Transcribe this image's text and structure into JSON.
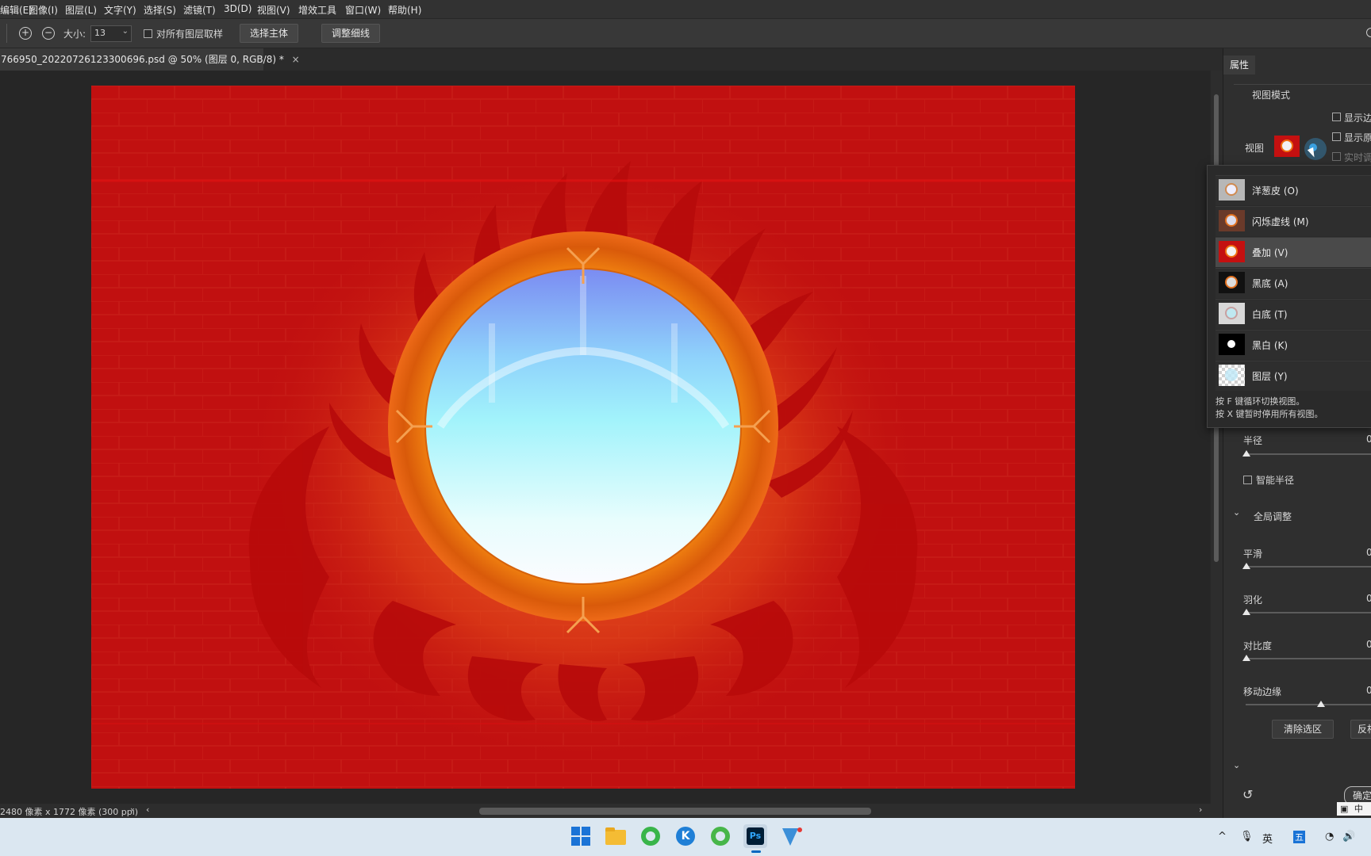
{
  "menu": [
    "编辑(E)",
    "图像(I)",
    "图层(L)",
    "文字(Y)",
    "选择(S)",
    "滤镜(T)",
    "3D(D)",
    "视图(V)",
    "增效工具",
    "窗口(W)",
    "帮助(H)"
  ],
  "options_bar": {
    "size_label": "大小:",
    "size_value": "13",
    "sample_all_layers_label": "对所有图层取样",
    "select_subject_button": "选择主体",
    "refine_hair_button": "调整细线"
  },
  "document_tab": {
    "title": "766950_20220726123300696.psd @ 50% (图层 0, RGB/8) *",
    "close_glyph": "×"
  },
  "status_bar": {
    "doc_info": "2480 像素 x 1772 像素 (300 ppi)",
    "arrow": "›",
    "scroll_left": "‹",
    "scroll_right": "›"
  },
  "properties_panel": {
    "tab_label": "属性",
    "view_mode_section": "视图模式",
    "view_label": "视图",
    "show_edge_checkbox": "显示边",
    "show_original_checkbox": "显示原",
    "realtime_checkbox": "实时调",
    "radius_label": "半径",
    "radius_value": "0",
    "smart_radius_label": "智能半径",
    "global_refine_section": "全局调整",
    "smooth_label": "平滑",
    "smooth_value": "0",
    "feather_label": "羽化",
    "feather_value": "0",
    "contrast_label": "对比度",
    "contrast_value": "0",
    "shift_edge_label": "移动边缘",
    "shift_edge_value": "0",
    "shift_edge_position": 0.5,
    "clear_selection_button": "清除选区",
    "invert_button": "反相",
    "ok_button": "确定"
  },
  "view_dropdown": {
    "items": [
      {
        "label": "洋葱皮 (O)",
        "icon": "onion-skin-thumb"
      },
      {
        "label": "闪烁虚线 (M)",
        "icon": "marching-ants-thumb"
      },
      {
        "label": "叠加 (V)",
        "icon": "overlay-thumb",
        "selected": true
      },
      {
        "label": "黑底 (A)",
        "icon": "on-black-thumb"
      },
      {
        "label": "白底 (T)",
        "icon": "on-white-thumb"
      },
      {
        "label": "黑白 (K)",
        "icon": "black-white-thumb"
      },
      {
        "label": "图层 (Y)",
        "icon": "on-layers-thumb"
      }
    ],
    "hint_1": "按 F 键循环切换视图。",
    "hint_2": "按 X 键暂时停用所有视图。"
  },
  "taskbar": {
    "icons": [
      "windows-start-icon",
      "file-explorer-icon",
      "browser-icon",
      "k-app-icon",
      "browser-2-icon",
      "photoshop-icon",
      "design-app-icon"
    ],
    "ps_label": "Ps",
    "k_label": "K",
    "tray_ime": "英",
    "tray_ime_cn": "中",
    "tray_box": "五",
    "ime_bar": "中"
  },
  "colors": {
    "canvas_red": "#c01010",
    "ring_orange": "#e4640c",
    "accent_blue": "#3aa0e0"
  }
}
